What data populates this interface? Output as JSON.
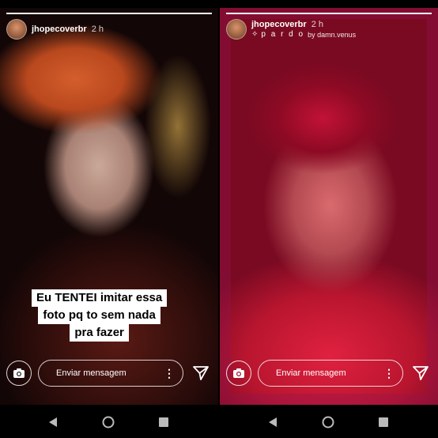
{
  "stories": [
    {
      "username": "jhopecoverbr",
      "time": "2 h",
      "progress": 1.0,
      "caption_lines": [
        "Eu TENTEI imitar essa",
        "foto pq to sem nada",
        "pra fazer"
      ],
      "reply_placeholder": "Enviar mensagem"
    },
    {
      "username": "jhopecoverbr",
      "time": "2 h",
      "progress": 1.0,
      "music": {
        "song": "p a r d o",
        "artist": "by damn.venus",
        "icon": "music-sparkle-icon"
      },
      "reply_placeholder": "Enviar mensagem"
    }
  ],
  "icons": {
    "camera": "camera-icon",
    "more": "more-vertical-icon",
    "send": "send-icon",
    "back": "back-triangle-icon",
    "home": "home-circle-icon",
    "recents": "recents-square-icon"
  }
}
